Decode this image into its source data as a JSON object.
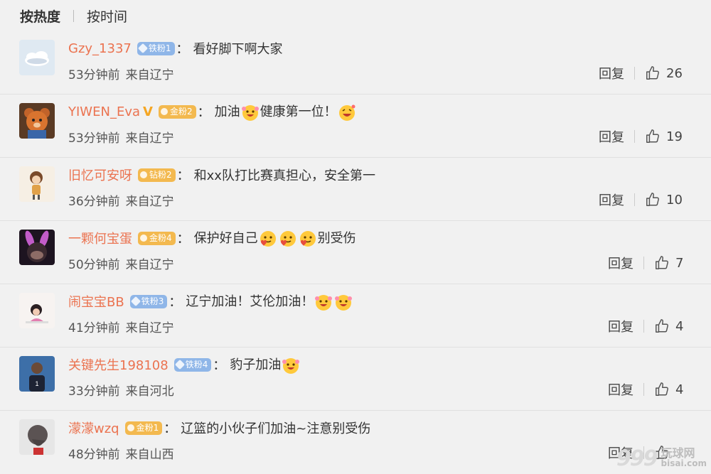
{
  "sort": {
    "hot_label": "按热度",
    "time_label": "按时间"
  },
  "colors": {
    "username": "#eb7350",
    "badge_blue": "#8fb6e8",
    "badge_gold": "#f3b94f",
    "background": "#f1f1f1"
  },
  "reply_label": "回复",
  "comments": [
    {
      "username": "Gzy_1337",
      "verified": "",
      "badge": {
        "label": "铁粉1",
        "type": "blue"
      },
      "segments": [
        {
          "t": "看好脚下啊大家"
        }
      ],
      "time": "53分钟前",
      "location": "来自辽宁",
      "likes": "26",
      "avatar": "cloud-avatar"
    },
    {
      "username": "YIWEN_Eva",
      "verified": "V",
      "badge": {
        "label": "金粉2",
        "type": "gold"
      },
      "segments": [
        {
          "t": "加油"
        },
        {
          "e": "cheer-emoji"
        },
        {
          "t": "健康第一位！"
        },
        {
          "e": "grin-emoji"
        }
      ],
      "time": "53分钟前",
      "location": "来自辽宁",
      "likes": "19",
      "avatar": "bear-avatar"
    },
    {
      "username": "旧忆可安呀",
      "verified": "",
      "badge": {
        "label": "钻粉2",
        "type": "gold"
      },
      "segments": [
        {
          "t": "和xx队打比赛真担心，安全第一"
        }
      ],
      "time": "36分钟前",
      "location": "来自辽宁",
      "likes": "10",
      "avatar": "girl-avatar"
    },
    {
      "username": "一颗何宝蛋",
      "verified": "",
      "badge": {
        "label": "金粉4",
        "type": "gold"
      },
      "segments": [
        {
          "t": "保护好自己"
        },
        {
          "e": "heart-face-emoji"
        },
        {
          "e": "heart-face-emoji"
        },
        {
          "e": "heart-face-emoji"
        },
        {
          "t": "别受伤"
        }
      ],
      "time": "50分钟前",
      "location": "来自辽宁",
      "likes": "7",
      "avatar": "bunny-avatar"
    },
    {
      "username": "闹宝宝BB",
      "verified": "",
      "badge": {
        "label": "铁粉3",
        "type": "blue"
      },
      "segments": [
        {
          "t": "辽宁加油！艾伦加油！"
        },
        {
          "e": "cheer-emoji"
        },
        {
          "e": "cheer-emoji"
        }
      ],
      "time": "41分钟前",
      "location": "来自辽宁",
      "likes": "4",
      "avatar": "kid-avatar"
    },
    {
      "username": "关键先生198108",
      "verified": "",
      "badge": {
        "label": "铁粉4",
        "type": "blue"
      },
      "segments": [
        {
          "t": "豹子加油"
        },
        {
          "e": "cheer-emoji"
        }
      ],
      "time": "33分钟前",
      "location": "来自河北",
      "likes": "4",
      "avatar": "player-avatar"
    },
    {
      "username": "濛濛wzq",
      "verified": "",
      "badge": {
        "label": "金粉1",
        "type": "gold"
      },
      "segments": [
        {
          "t": "辽篮的小伙子们加油~注意别受伤"
        }
      ],
      "time": "48分钟前",
      "location": "来自山西",
      "likes": "",
      "avatar": "hair-avatar"
    }
  ],
  "watermark": {
    "number": "999",
    "cn": "玩球网",
    "en": "bisai.com"
  }
}
